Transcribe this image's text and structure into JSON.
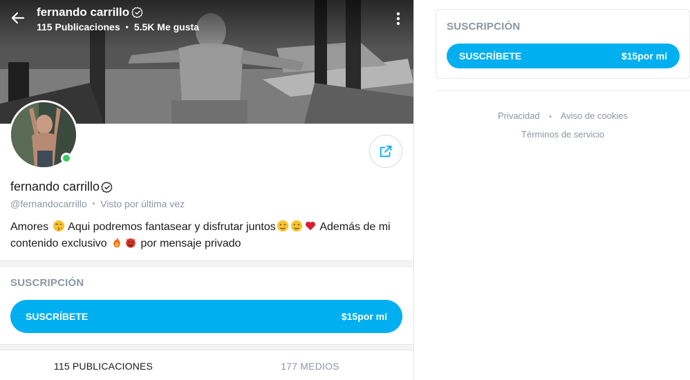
{
  "header": {
    "name": "fernando carrillo",
    "posts_stat": "115 Publicaciones",
    "likes_stat": "5.5K Me gusta",
    "stat_separator": "•"
  },
  "profile": {
    "name": "fernando carrillo",
    "handle": "@fernandocarrillo",
    "sub_separator": "•",
    "last_seen": "Visto por última vez",
    "online": true,
    "bio": {
      "part1": "Amores",
      "part2": "Aqui podremos fantasear y disfrutar juntos",
      "part3": "Además de mi",
      "part4": "contenido exclusivo",
      "part5": "por mensaje privado"
    }
  },
  "subscription": {
    "title": "SUSCRIPCIÓN",
    "button_label": "SUSCRÍBETE",
    "price": "$15por mí"
  },
  "tabs": [
    {
      "label": "115 PUBLICACIONES",
      "active": true
    },
    {
      "label": "177 MEDIOS",
      "active": false
    }
  ],
  "sidebar": {
    "subscription_title": "SUSCRIPCIÓN",
    "button_label": "SUSCRÍBETE",
    "price": "$15por mí",
    "footer": {
      "privacy": "Privacidad",
      "separator": "•",
      "cookies": "Aviso de cookies",
      "terms": "Términos de servicio"
    }
  },
  "icons": {
    "back": "arrow-left-icon",
    "more": "vertical-dots-icon",
    "verified": "verified-check-icon",
    "share": "share-icon"
  },
  "colors": {
    "accent": "#00aff0",
    "muted": "#8a96a3",
    "online": "#3dc764"
  }
}
